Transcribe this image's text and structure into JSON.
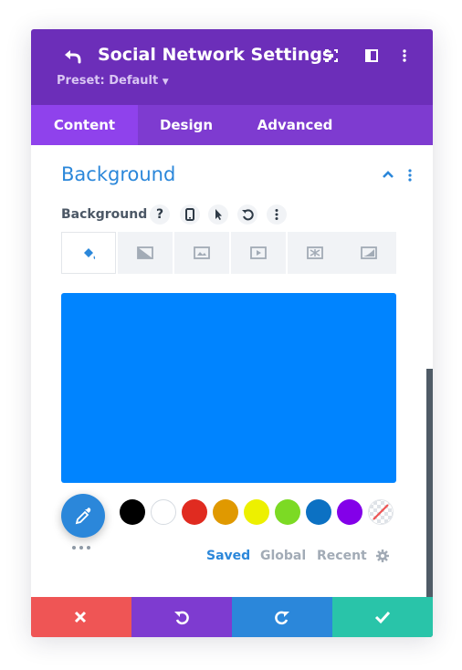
{
  "header": {
    "title": "Social Network Settings",
    "preset": "Preset: Default",
    "color": "#6c2eb9"
  },
  "tabs": [
    {
      "label": "Content",
      "active": true
    },
    {
      "label": "Design",
      "active": false
    },
    {
      "label": "Advanced",
      "active": false
    }
  ],
  "section": {
    "title": "Background",
    "field_label": "Background",
    "help_glyph": "?"
  },
  "background_types": [
    "color",
    "gradient",
    "image",
    "video",
    "pattern",
    "mask"
  ],
  "preview_color": "#0084ff",
  "swatches": [
    "#000000",
    "#ffffff",
    "#e02b20",
    "#e09900",
    "#edf000",
    "#7cda24",
    "#0c71c3",
    "#8300e9",
    "transparent"
  ],
  "palette_tabs": {
    "saved": "Saved",
    "global": "Global",
    "recent": "Recent",
    "active": "Saved"
  },
  "footer_colors": {
    "discard": "#ef5555",
    "undo": "#7e3bd0",
    "redo": "#2b87da",
    "save": "#29c4a9"
  }
}
